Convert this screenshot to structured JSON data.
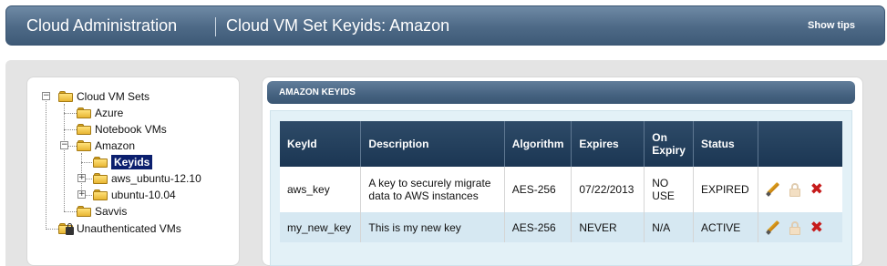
{
  "header": {
    "title": "Cloud Administration",
    "subtitle": "Cloud VM Set Keyids: Amazon",
    "show_tips": "Show tips"
  },
  "tree": {
    "root": "Cloud VM Sets",
    "items": [
      {
        "label": "Azure"
      },
      {
        "label": "Notebook VMs"
      },
      {
        "label": "Amazon"
      },
      {
        "label": "Keyids",
        "selected": true
      },
      {
        "label": "aws_ubuntu-12.10"
      },
      {
        "label": "ubuntu-10.04"
      },
      {
        "label": "Savvis"
      }
    ],
    "unauthenticated": "Unauthenticated VMs",
    "expander_collapse": "−",
    "expander_expand": "+"
  },
  "panel": {
    "title": "AMAZON KEYIDS",
    "columns": [
      "KeyId",
      "Description",
      "Algorithm",
      "Expires",
      "On Expiry",
      "Status",
      ""
    ],
    "rows": [
      {
        "keyid": "aws_key",
        "description": "A key to securely migrate data to AWS instances",
        "algorithm": "AES-256",
        "expires": "07/22/2013",
        "on_expiry": "NO USE",
        "status": "EXPIRED"
      },
      {
        "keyid": "my_new_key",
        "description": "This is my new key",
        "algorithm": "AES-256",
        "expires": "NEVER",
        "on_expiry": "N/A",
        "status": "ACTIVE"
      }
    ],
    "delete_glyph": "✖"
  },
  "icons": {
    "folder": "folder-icon",
    "edit": "pencil-icon",
    "lock": "unlock-icon",
    "delete": "delete-icon"
  },
  "colors": {
    "header_bg": "#4d6986",
    "selected_node_bg": "#0b1f6e",
    "table_header_bg": "#1b3653",
    "row_alt_bg": "#d6e8f2",
    "delete_red": "#c61b1b"
  }
}
